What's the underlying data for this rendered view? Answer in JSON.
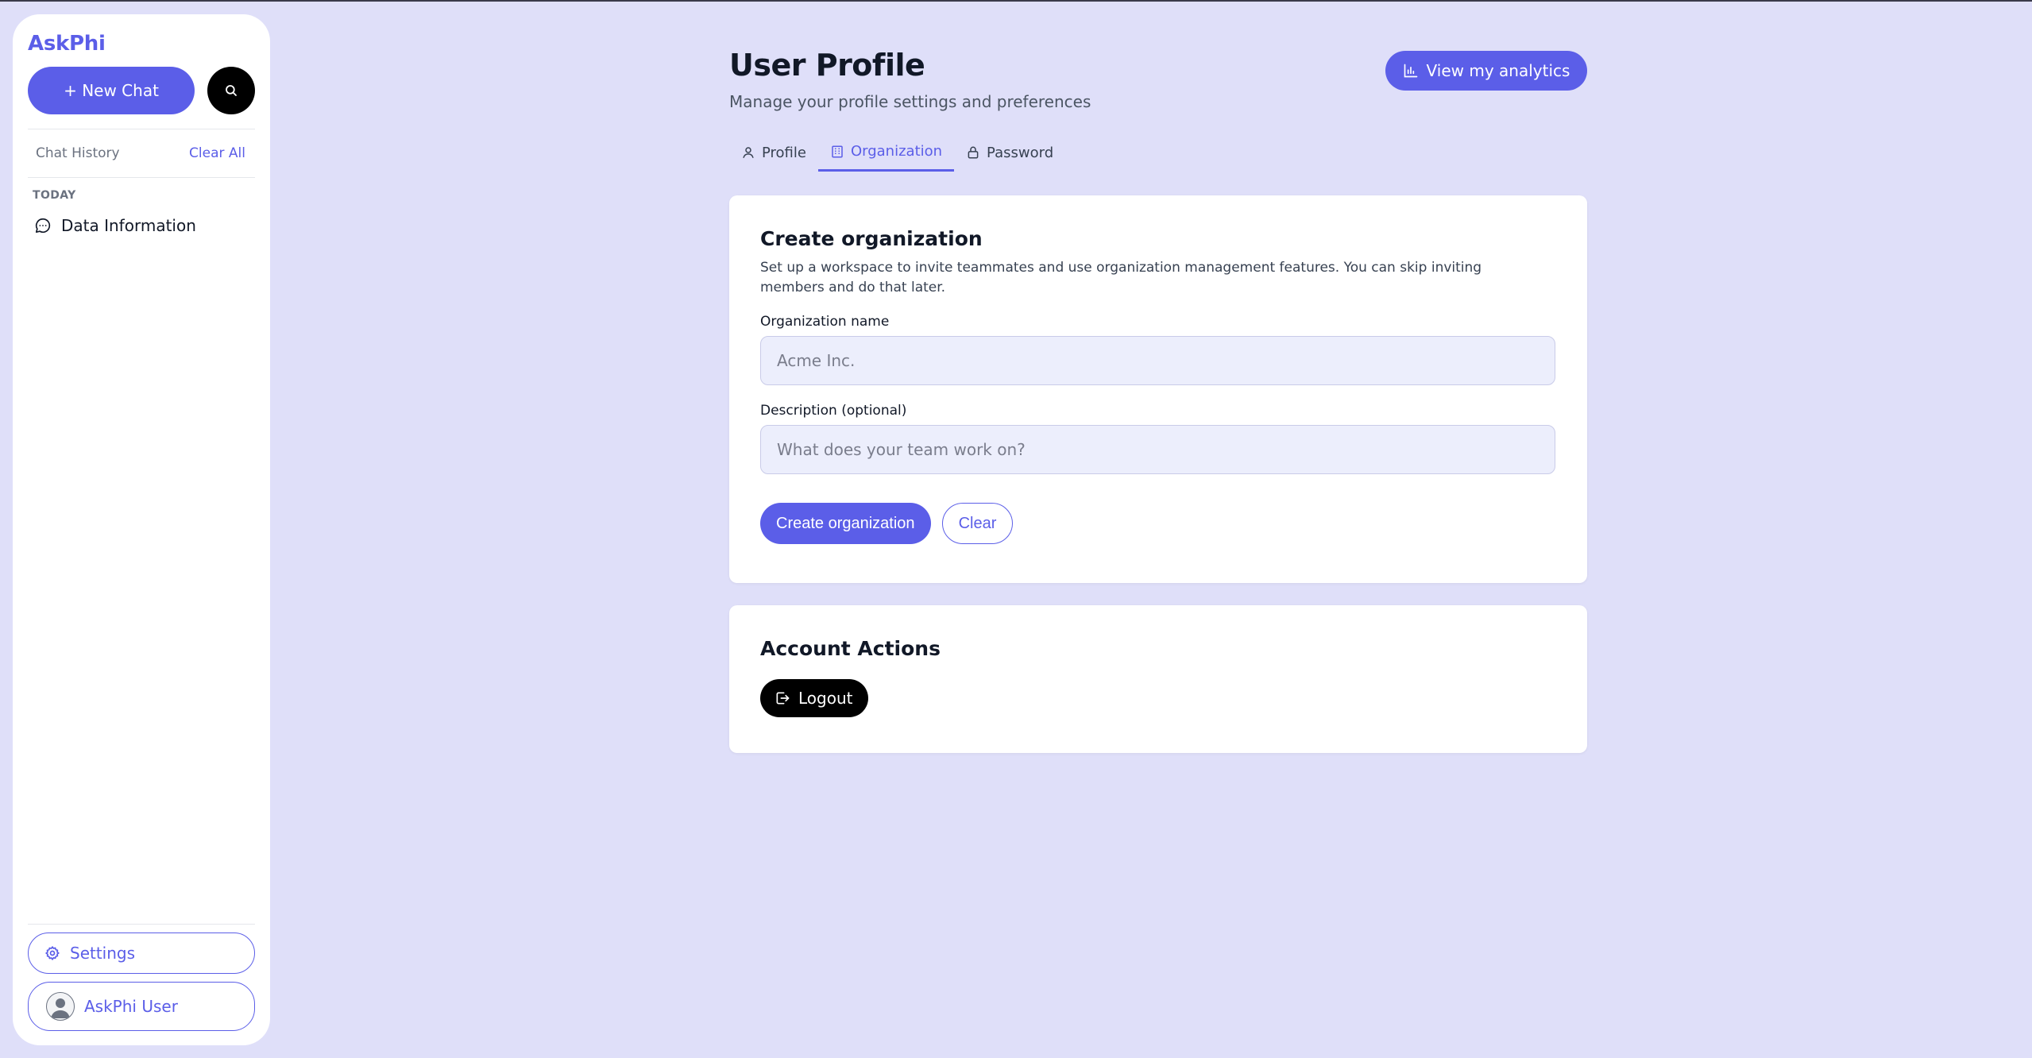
{
  "sidebar": {
    "brand": "AskPhi",
    "new_chat_label": "+ New Chat",
    "search_icon": "search-icon",
    "history_label": "Chat History",
    "clear_all_label": "Clear All",
    "section_today": "TODAY",
    "chats": [
      {
        "label": "Data Information",
        "icon": "chat-bubble-icon"
      }
    ],
    "settings_label": "Settings",
    "user_label": "AskPhi User"
  },
  "header": {
    "title": "User Profile",
    "subtitle": "Manage your profile settings and preferences",
    "analytics_label": "View my analytics"
  },
  "tabs": [
    {
      "label": "Profile",
      "icon": "user-icon",
      "active": false
    },
    {
      "label": "Organization",
      "icon": "building-icon",
      "active": true
    },
    {
      "label": "Password",
      "icon": "lock-icon",
      "active": false
    }
  ],
  "org_form": {
    "title": "Create organization",
    "description": "Set up a workspace to invite teammates and use organization management features. You can skip inviting members and do that later.",
    "name_label": "Organization name",
    "name_placeholder": "Acme Inc.",
    "name_value": "",
    "desc_label": "Description (optional)",
    "desc_placeholder": "What does your team work on?",
    "desc_value": "",
    "create_label": "Create organization",
    "clear_label": "Clear"
  },
  "account": {
    "title": "Account Actions",
    "logout_label": "Logout"
  },
  "colors": {
    "background": "#dfdff9",
    "accent": "#5b5ee8",
    "card": "#ffffff",
    "input_bg": "#eceefc"
  }
}
